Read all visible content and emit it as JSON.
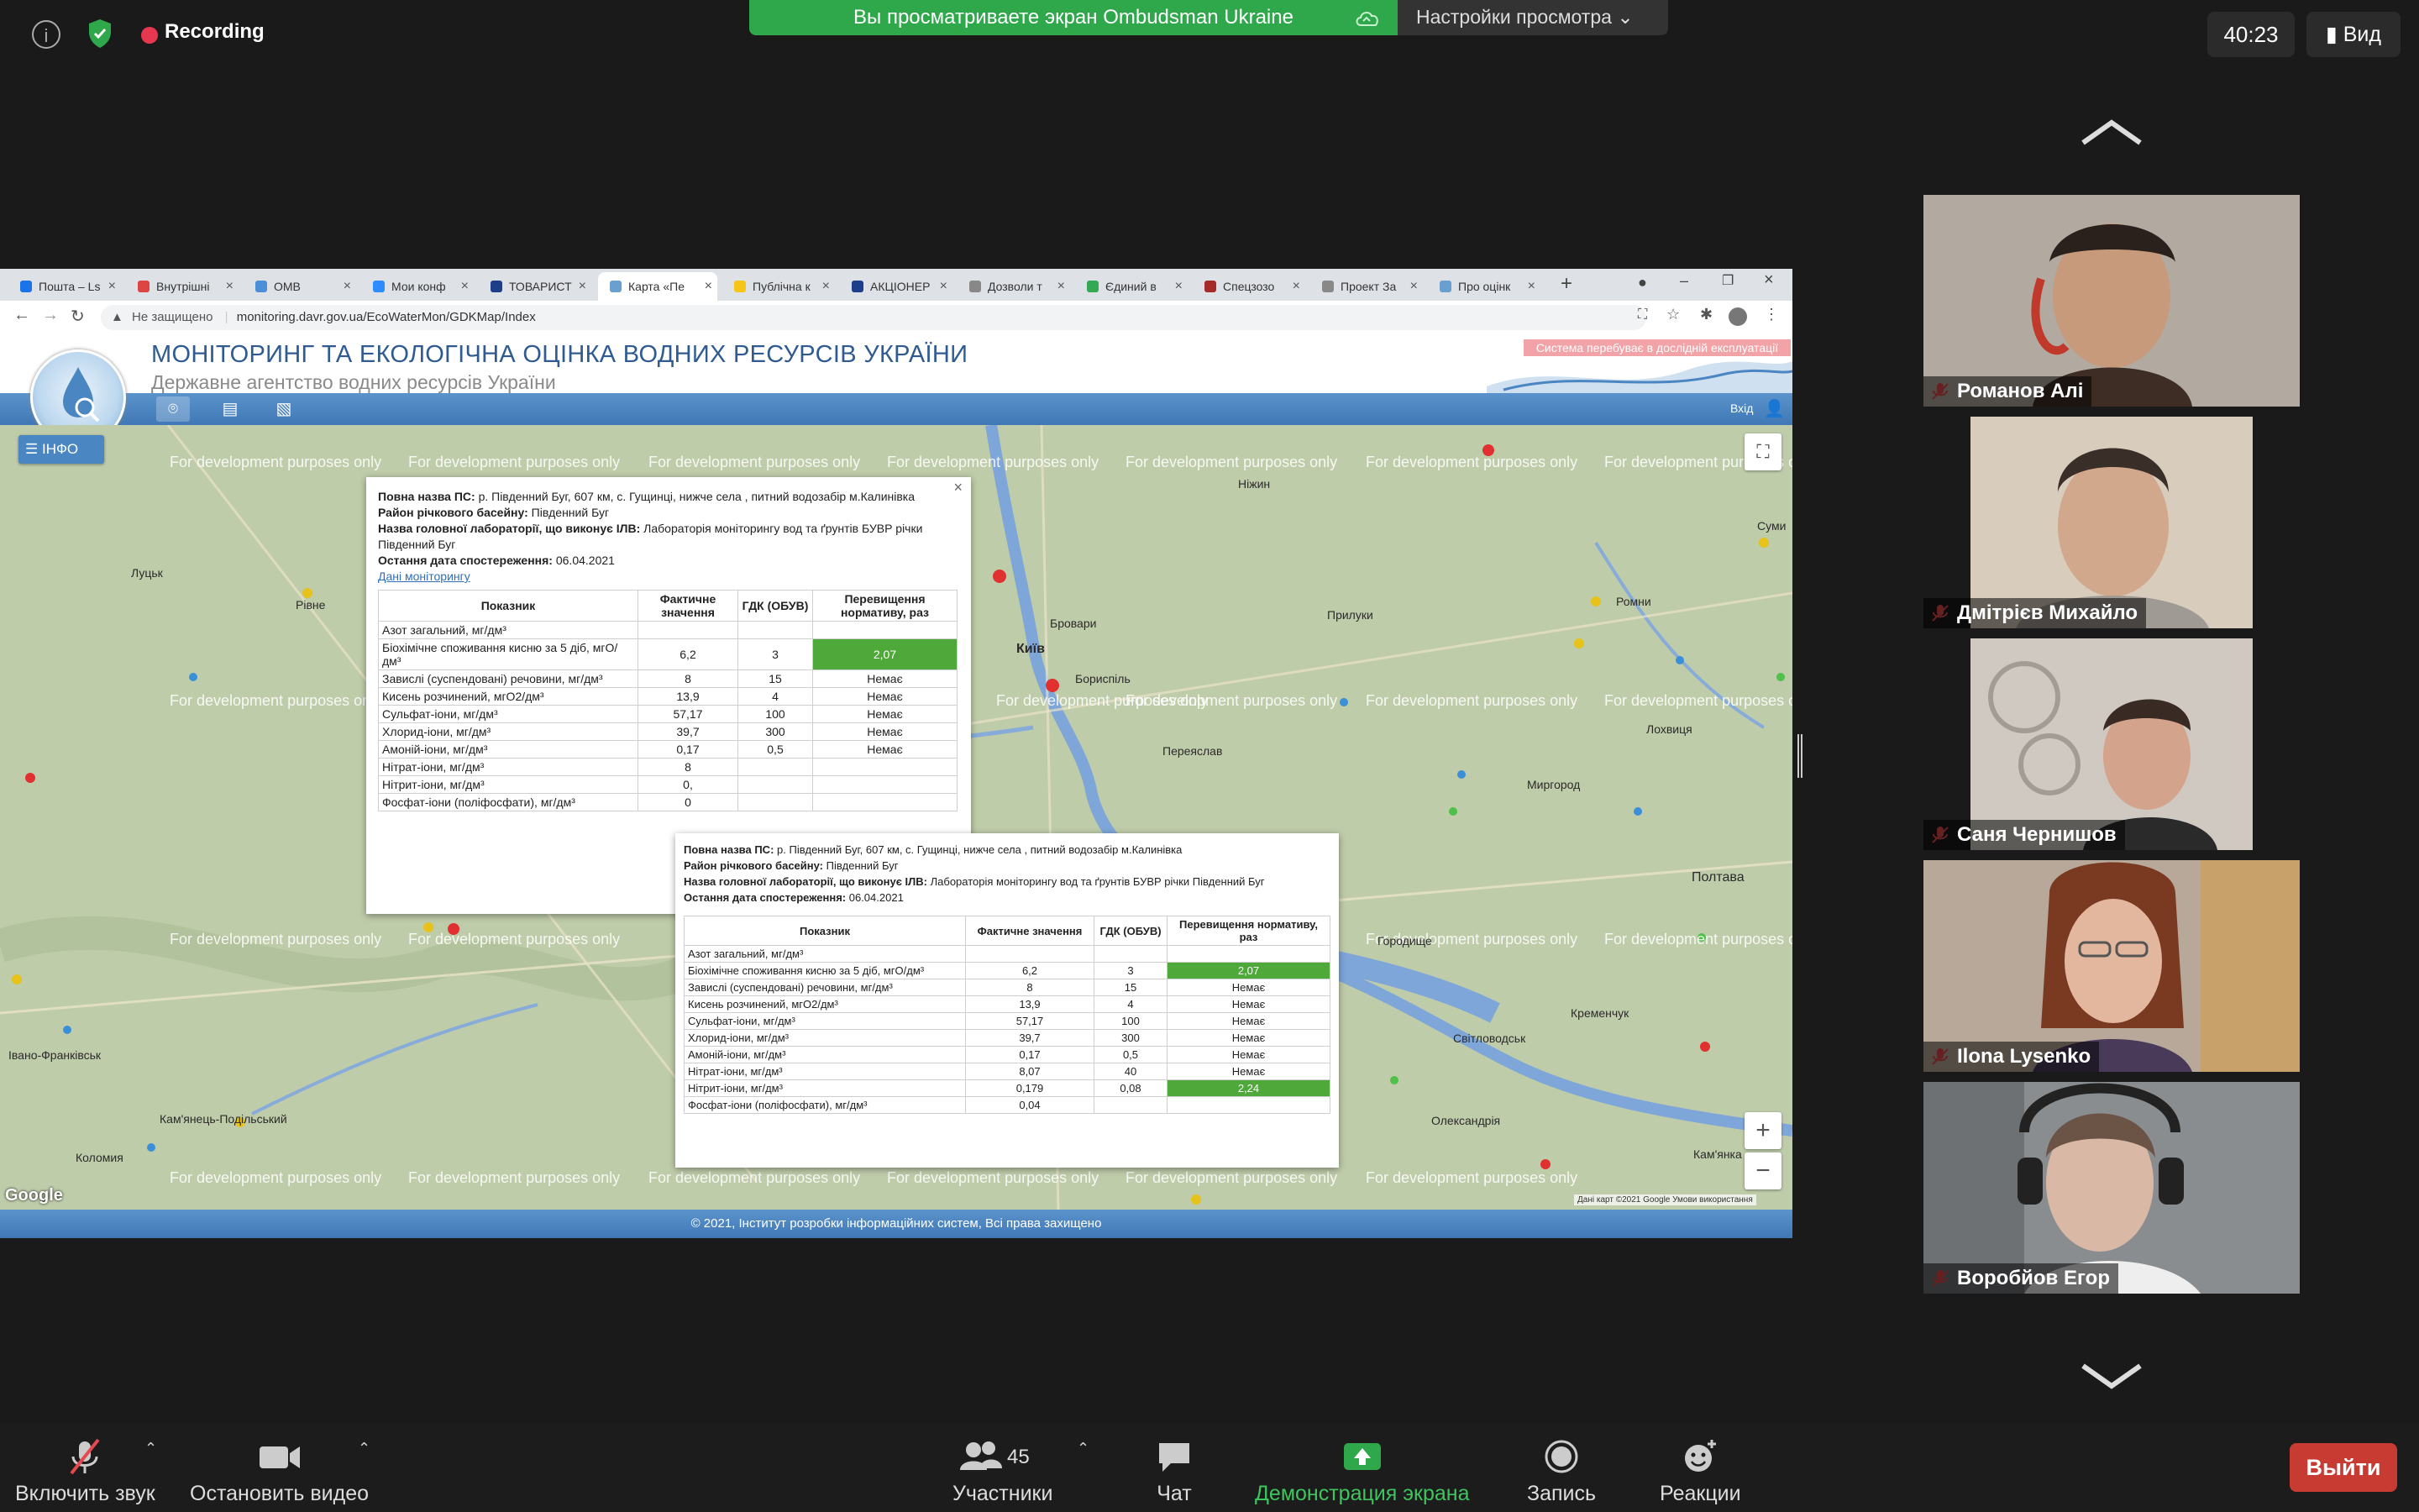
{
  "zoom_top": {
    "recording_label": "Recording",
    "share_banner": "Вы просматриваете экран Ombudsman Ukraine",
    "view_settings_label": "Настройки просмотра",
    "timer": "40:23",
    "view_label": "Вид"
  },
  "browser": {
    "tabs": [
      {
        "label": "Пошта – Ls"
      },
      {
        "label": "Внутрішні"
      },
      {
        "label": "OMB"
      },
      {
        "label": "Мои конф"
      },
      {
        "label": "ТОВАРИСТ"
      },
      {
        "label": "Карта «Пе"
      },
      {
        "label": "Публічна к"
      },
      {
        "label": "АКЦІОНЕР"
      },
      {
        "label": "Дозволи т"
      },
      {
        "label": "Єдиний в"
      },
      {
        "label": "Спецзозо"
      },
      {
        "label": "Проект За"
      },
      {
        "label": "Про оцінк"
      }
    ],
    "security_label": "Не защищено",
    "url": "monitoring.davr.gov.ua/EcoWaterMon/GDKMap/Index"
  },
  "site": {
    "title": "МОНІТОРИНГ ТА ЕКОЛОГІЧНА ОЦІНКА ВОДНИХ РЕСУРСІВ УКРАЇНИ",
    "subtitle": "Державне агентство водних ресурсів України",
    "beta_notice": "Система перебуває в дослідній експлуатації",
    "exit_label": "Вхід",
    "info_button": "ІНФО",
    "watermark": "For development purposes only",
    "google_label": "Google",
    "map_credit": "Дані карт ©2021 Google  Умови використання",
    "footer": "© 2021, Інститут розробки інформаційних систем, Всі права захищено"
  },
  "map_labels": {
    "kyiv": "Київ",
    "brovary": "Бровари",
    "boryspil": "Бориспіль",
    "poltava": "Полтава",
    "kremenchuk": "Кременчук",
    "myrhorod": "Миргород",
    "svitlovodsk": "Світловодськ",
    "oleksandriia": "Олександрія",
    "pryluky": "Прилуки",
    "pereiaslav": "Переяслав",
    "nizhyn": "Ніжин",
    "rivne": "Рівне",
    "lutsk": "Луцьк",
    "ivano_frankivsk": "Івано-Франківськ",
    "kamianets": "Кам'янець-Подільський",
    "kolomyia": "Коломия",
    "sumy": "Суми",
    "romny": "Ромни",
    "horodyshche": "Городище",
    "kam_kam": "Кам'янка",
    "lokhvytsia": "Лохвиця"
  },
  "popup_back": {
    "name_label": "Повна назва ПС:",
    "name_value": "р. Південний Буг, 607 км, с. Гущинці, нижче села , питний водозабір м.Калинівка",
    "basin_label": "Район річкового басейну:",
    "basin_value": "Південний Буг",
    "lab_label": "Назва головної лабораторії, що виконує ІЛВ:",
    "lab_value": "Лабораторія моніторингу вод та ґрунтів БУВР річки Південний Буг",
    "date_label": "Остання дата спостереження:",
    "date_value": "06.04.2021",
    "link": "Дані моніторингу",
    "headers": [
      "Показник",
      "Фактичне значення",
      "ГДК (ОБУВ)",
      "Перевищення нормативу, раз"
    ],
    "rows": [
      {
        "name": "Азот загальний, мг/дм³",
        "fact": "",
        "gdk": "",
        "exc": ""
      },
      {
        "name": "Біохімічне споживання кисню за 5 діб, мгО/дм³",
        "fact": "6,2",
        "gdk": "3",
        "exc": "2,07"
      },
      {
        "name": "Завислі (суспендовані) речовини, мг/дм³",
        "fact": "8",
        "gdk": "15",
        "exc": "Немає"
      },
      {
        "name": "Кисень розчинений, мгО2/дм³",
        "fact": "13,9",
        "gdk": "4",
        "exc": "Немає"
      },
      {
        "name": "Сульфат-іони, мг/дм³",
        "fact": "57,17",
        "gdk": "100",
        "exc": "Немає"
      },
      {
        "name": "Хлорид-іони, мг/дм³",
        "fact": "39,7",
        "gdk": "300",
        "exc": "Немає"
      },
      {
        "name": "Амоній-іони, мг/дм³",
        "fact": "0,17",
        "gdk": "0,5",
        "exc": "Немає"
      },
      {
        "name": "Нітрат-іони, мг/дм³",
        "fact": "8",
        "gdk": "",
        "exc": ""
      },
      {
        "name": "Нітрит-іони, мг/дм³",
        "fact": "0,",
        "gdk": "",
        "exc": ""
      },
      {
        "name": "Фосфат-іони (поліфосфати), мг/дм³",
        "fact": "0",
        "gdk": "",
        "exc": ""
      }
    ]
  },
  "popup_front": {
    "name_label": "Повна назва ПС:",
    "name_value": "р. Південний Буг, 607 км, с. Гущинці, нижче села , питний водозабір м.Калинівка",
    "basin_label": "Район річкового басейну:",
    "basin_value": "Південний Буг",
    "lab_label": "Назва головної лабораторії, що виконує ІЛВ:",
    "lab_value": "Лабораторія моніторингу вод та ґрунтів БУВР річки Південний Буг",
    "date_label": "Остання дата спостереження:",
    "date_value": "06.04.2021",
    "headers": [
      "Показник",
      "Фактичне значення",
      "ГДК (ОБУВ)",
      "Перевищення нормативу, раз"
    ],
    "rows": [
      {
        "name": "Азот загальний, мг/дм³",
        "fact": "",
        "gdk": "",
        "exc": ""
      },
      {
        "name": "Біохімічне споживання кисню за 5 діб, мгО/дм³",
        "fact": "6,2",
        "gdk": "3",
        "exc": "2,07"
      },
      {
        "name": "Завислі (суспендовані) речовини, мг/дм³",
        "fact": "8",
        "gdk": "15",
        "exc": "Немає"
      },
      {
        "name": "Кисень розчинений, мгО2/дм³",
        "fact": "13,9",
        "gdk": "4",
        "exc": "Немає"
      },
      {
        "name": "Сульфат-іони, мг/дм³",
        "fact": "57,17",
        "gdk": "100",
        "exc": "Немає"
      },
      {
        "name": "Хлорид-іони, мг/дм³",
        "fact": "39,7",
        "gdk": "300",
        "exc": "Немає"
      },
      {
        "name": "Амоній-іони, мг/дм³",
        "fact": "0,17",
        "gdk": "0,5",
        "exc": "Немає"
      },
      {
        "name": "Нітрат-іони, мг/дм³",
        "fact": "8,07",
        "gdk": "40",
        "exc": "Немає"
      },
      {
        "name": "Нітрит-іони, мг/дм³",
        "fact": "0,179",
        "gdk": "0,08",
        "exc": "2,24"
      },
      {
        "name": "Фосфат-іони (поліфосфати), мг/дм³",
        "fact": "0,04",
        "gdk": "",
        "exc": ""
      }
    ]
  },
  "participants": [
    {
      "name": "Романов Алі",
      "color": "#6b5a4a"
    },
    {
      "name": "Дмітрієв Михайло",
      "color": "#8b7b6e"
    },
    {
      "name": "Саня Чернишов",
      "color": "#9a8f86"
    },
    {
      "name": "Ilona Lysenko",
      "color": "#7a6052"
    },
    {
      "name": "Воробйов Егор",
      "color": "#5d5d5d"
    }
  ],
  "bottom_bar": {
    "mute": "Включить звук",
    "video": "Остановить видео",
    "participants_count": "45",
    "participants": "Участники",
    "chat": "Чат",
    "share": "Демонстрация экрана",
    "record": "Запись",
    "reactions": "Реакции",
    "leave": "Выйти"
  },
  "colors": {
    "share_green": "#2ea84a",
    "leave_red": "#c73b33",
    "exceed_green": "#4fa83a",
    "site_blue": "#3f78b5"
  }
}
